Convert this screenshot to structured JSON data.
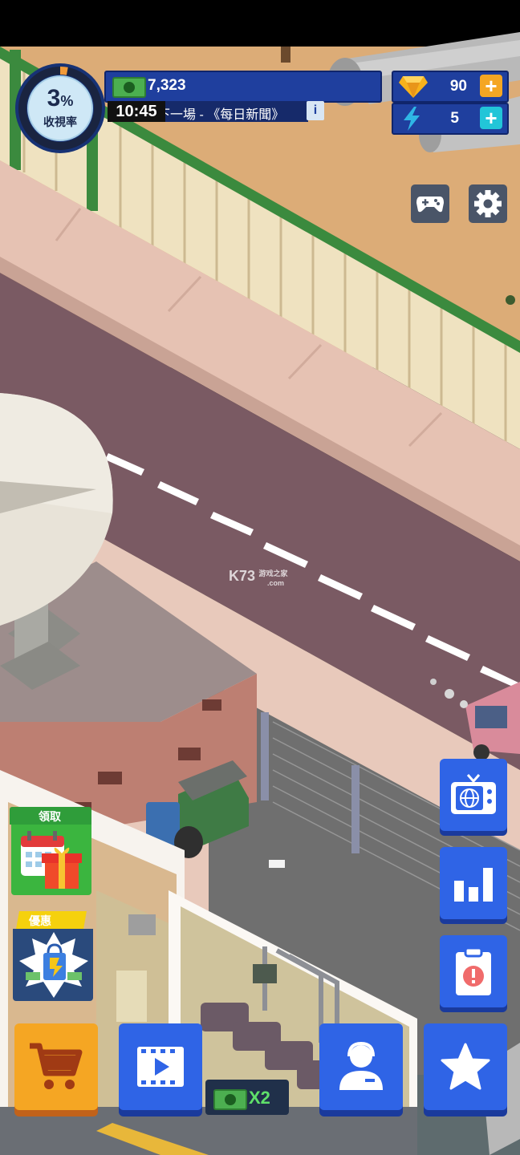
{
  "hud": {
    "rating_value": "3",
    "rating_unit": "%",
    "rating_label": "收視率",
    "rating_progress": 0.03,
    "money": "7,323",
    "time": "10:45",
    "ticker": "下一場 - 《每日新聞》",
    "info_label": "i",
    "gems": "90",
    "energy": "5"
  },
  "promos": {
    "daily_reward_label": "領取",
    "offer_label": "優惠"
  },
  "bottom": {
    "multiplier_label": "X2"
  },
  "watermark": {
    "brand": "K73",
    "sub": "游戏之家",
    "domain": ".com"
  },
  "colors": {
    "hud_blue": "#1f3f9e",
    "button_blue": "#2f64e6",
    "shop_orange": "#f5a623",
    "plus_orange": "#f5a623",
    "plus_cyan": "#22c5d8",
    "green_badge": "#2f9d3a",
    "yellow_badge": "#f5d10d"
  },
  "icons": [
    "gem-icon",
    "lightning-icon",
    "money-icon",
    "gamepad-icon",
    "gear-icon",
    "tv-globe-icon",
    "bar-chart-icon",
    "clipboard-alert-icon",
    "cart-icon",
    "video-icon",
    "staff-icon",
    "star-icon",
    "calendar-gift-icon",
    "shopping-bag-icon"
  ]
}
